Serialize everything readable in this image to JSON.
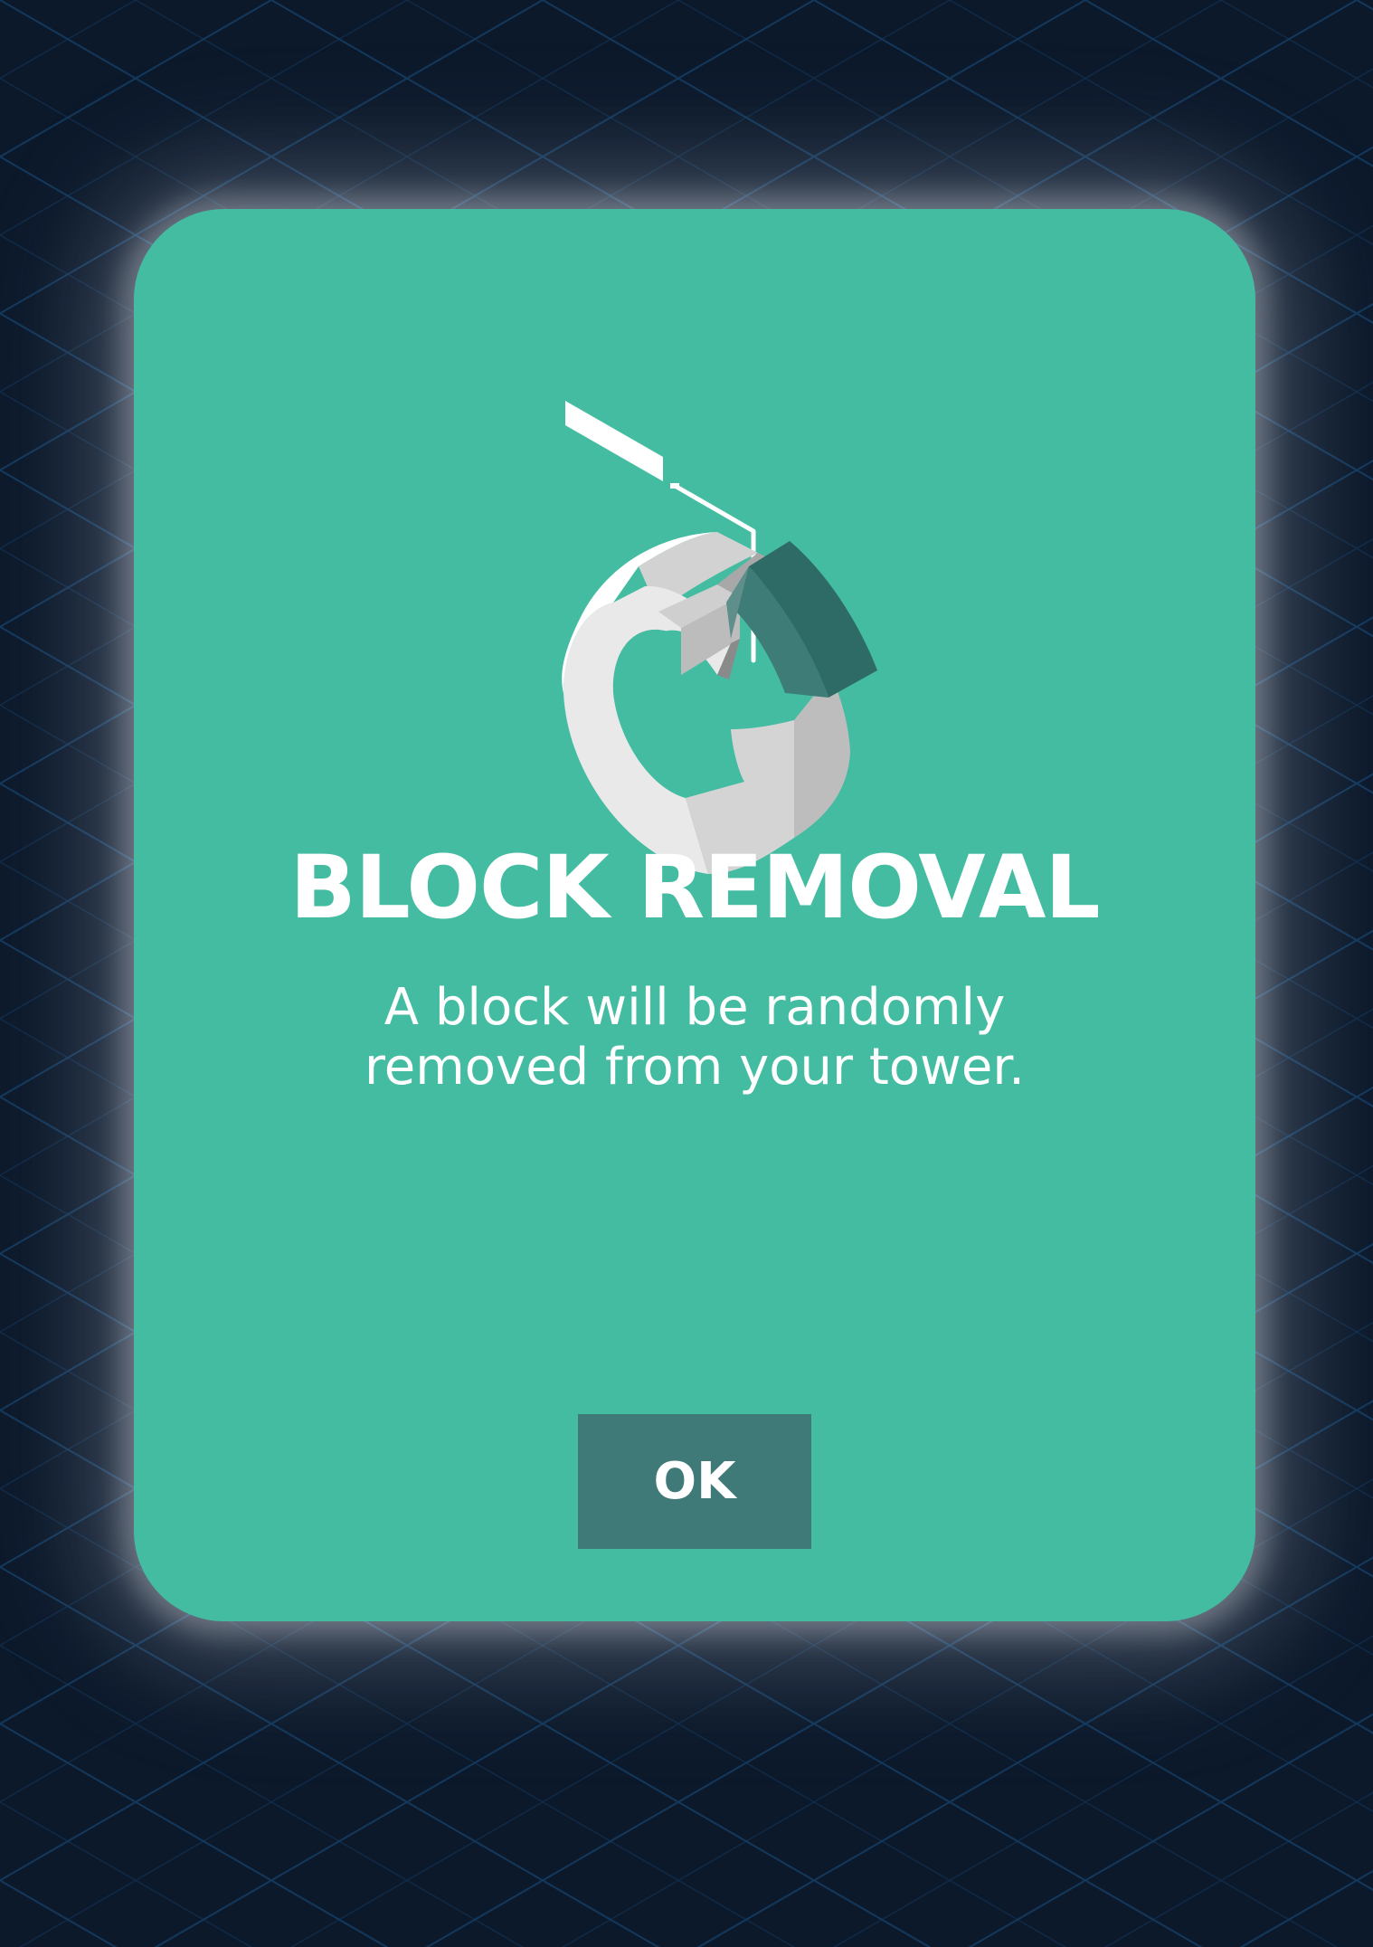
{
  "dialog": {
    "title": "BLOCK REMOVAL",
    "message_line_1": "A block will be randomly",
    "message_line_2": "removed from your tower.",
    "ok_label": "OK",
    "illustration_icon": "ring-block-removal-icon"
  },
  "colors": {
    "background": "#0c192b",
    "grid": "#13385c",
    "modal": "#43bca1",
    "button": "#3f7a78",
    "text": "#ffffff",
    "block_dark": "#2e6b66",
    "ring_light": "#e6e6e6"
  }
}
